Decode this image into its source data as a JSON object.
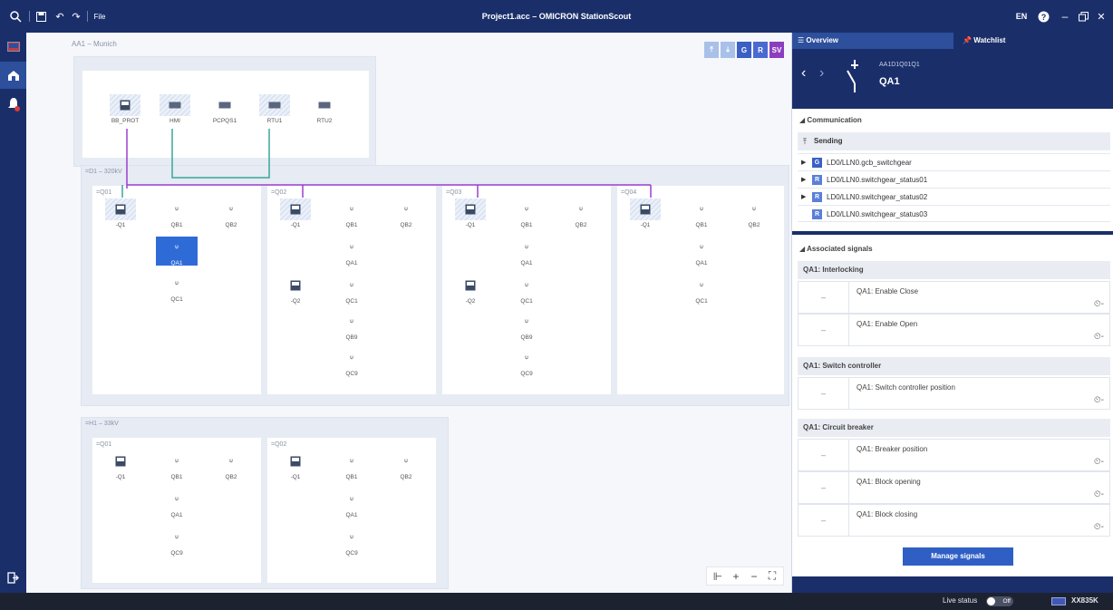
{
  "titlebar": {
    "title": "Project1.acc – OMICRON StationScout",
    "file_menu": "File",
    "language": "EN"
  },
  "canvas": {
    "breadcrumb": "AA1 – Munich",
    "toolbar_buttons": [
      {
        "label": "G",
        "color": "#3a5fc5"
      },
      {
        "label": "R",
        "color": "#4b6ad1"
      },
      {
        "label": "SV",
        "color": "#8b3fbf"
      }
    ],
    "top_devices": [
      "BB_PROT",
      "HMI",
      "PCPQS1",
      "RTU1",
      "RTU2"
    ],
    "d1": {
      "label": "=D1 – 320kV",
      "bays": [
        {
          "label": "=Q01",
          "ied": "-Q1",
          "q1": "QB1",
          "q2": "QB2",
          "q3": "QA1",
          "q4": "QC1"
        },
        {
          "label": "=Q02",
          "ied": "-Q1",
          "ied2": "-Q2",
          "q1": "QB1",
          "q2": "QB2",
          "q3": "QA1",
          "q4": "QC1",
          "q5": "QB9",
          "q6": "QC9"
        },
        {
          "label": "=Q03",
          "ied": "-Q1",
          "ied2": "-Q2",
          "q1": "QB1",
          "q2": "QB2",
          "q3": "QA1",
          "q4": "QC1",
          "q5": "QB9",
          "q6": "QC9"
        },
        {
          "label": "=Q04",
          "ied": "-Q1",
          "q1": "QB1",
          "q2": "QB2",
          "q3": "QA1",
          "q4": "QC1"
        }
      ]
    },
    "h1": {
      "label": "=H1 – 33kV",
      "bays": [
        {
          "label": "=Q01",
          "ied": "-Q1",
          "q1": "QB1",
          "q2": "QB2",
          "q3": "QA1",
          "q4": "QC9"
        },
        {
          "label": "=Q02",
          "ied": "-Q1",
          "q1": "QB1",
          "q2": "QB2",
          "q3": "QA1",
          "q4": "QC9"
        }
      ]
    },
    "colors": {
      "purple_line": "#9b3fcf",
      "teal_line": "#3aa69a",
      "selected": "#2f6bd7"
    }
  },
  "rpanel": {
    "tab_overview": "Overview",
    "tab_watchlist": "Watchlist",
    "device_path": "AA1D1Q01Q1",
    "device_name": "QA1",
    "communication": "Communication",
    "sending": "Sending",
    "send_items": [
      {
        "name": "LD0/LLN0.gcb_switchgear",
        "expand": "▶",
        "tag": "G"
      },
      {
        "name": "LD0/LLN0.switchgear_status01",
        "expand": "▶",
        "tag": "R"
      },
      {
        "name": "LD0/LLN0.switchgear_status02",
        "expand": "▶",
        "tag": "R"
      },
      {
        "name": "LD0/LLN0.switchgear_status03",
        "expand": "",
        "tag": "R"
      }
    ],
    "associated": "Associated signals",
    "categories": [
      {
        "name": "QA1: Interlocking",
        "signals": [
          "QA1: Enable Close",
          "QA1: Enable Open"
        ]
      },
      {
        "name": "QA1: Switch controller",
        "signals": [
          "QA1: Switch controller position"
        ]
      },
      {
        "name": "QA1: Circuit breaker",
        "signals": [
          "QA1: Breaker position",
          "QA1: Block opening",
          "QA1: Block closing"
        ]
      }
    ],
    "dash": "–",
    "manage_button": "Manage signals"
  },
  "statusbar": {
    "live_status": "Live status",
    "toggle": "Off",
    "device": "XX835K"
  }
}
